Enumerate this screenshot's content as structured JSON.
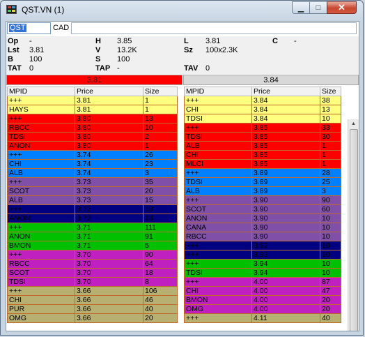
{
  "window": {
    "title": "QST.VN (1)"
  },
  "symbol": {
    "value": "QST",
    "exchange": "CAD"
  },
  "quote": {
    "op_label": "Op",
    "op": "-",
    "h_label": "H",
    "h": "3.85",
    "l_label": "L",
    "l": "3.81",
    "c_label": "C",
    "c": "-",
    "lst_label": "Lst",
    "lst": "3.81",
    "v_label": "V",
    "v": "13.2K",
    "sz_label": "Sz",
    "sz": "100x2.3K",
    "b_label": "B",
    "b": "100",
    "s_label": "S",
    "s": "100",
    "tat_label": "TAT",
    "tat": "0",
    "tap_label": "TAP",
    "tap": "-",
    "tav_label": "TAV",
    "tav": "0"
  },
  "bid_price": "3.81",
  "ask_price": "3.84",
  "headers": {
    "mpid": "MPID",
    "price": "Price",
    "size": "Size"
  },
  "bids": [
    {
      "mpid": "+++",
      "price": "3.81",
      "size": "1",
      "bg": "#ffff80",
      "fg": "#000"
    },
    {
      "mpid": "HAYS",
      "price": "3.81",
      "size": "1",
      "bg": "#ffff80",
      "fg": "#000"
    },
    {
      "mpid": "+++",
      "price": "3.80",
      "size": "13",
      "bg": "#ff0000",
      "fg": "#000"
    },
    {
      "mpid": "RBCC",
      "price": "3.80",
      "size": "10",
      "bg": "#ff0000",
      "fg": "#000"
    },
    {
      "mpid": "TDSI",
      "price": "3.80",
      "size": "2",
      "bg": "#ff0000",
      "fg": "#000"
    },
    {
      "mpid": "ANON",
      "price": "3.80",
      "size": "1",
      "bg": "#ff0000",
      "fg": "#000"
    },
    {
      "mpid": "+++",
      "price": "3.74",
      "size": "26",
      "bg": "#0080ff",
      "fg": "#000"
    },
    {
      "mpid": "CHI",
      "price": "3.74",
      "size": "23",
      "bg": "#0080ff",
      "fg": "#000"
    },
    {
      "mpid": "ALB",
      "price": "3.74",
      "size": "3",
      "bg": "#0080ff",
      "fg": "#000"
    },
    {
      "mpid": "+++",
      "price": "3.73",
      "size": "35",
      "bg": "#8050a8",
      "fg": "#000"
    },
    {
      "mpid": "SCOT",
      "price": "3.73",
      "size": "20",
      "bg": "#8050a8",
      "fg": "#000"
    },
    {
      "mpid": "ALB",
      "price": "3.73",
      "size": "15",
      "bg": "#8050a8",
      "fg": "#000"
    },
    {
      "mpid": "+++",
      "price": "3.72",
      "size": "18",
      "bg": "#000080",
      "fg": "#000"
    },
    {
      "mpid": "ANON",
      "price": "3.72",
      "size": "18",
      "bg": "#000080",
      "fg": "#000"
    },
    {
      "mpid": "+++",
      "price": "3.71",
      "size": "111",
      "bg": "#00c000",
      "fg": "#000"
    },
    {
      "mpid": "ANON",
      "price": "3.71",
      "size": "91",
      "bg": "#00c000",
      "fg": "#000"
    },
    {
      "mpid": "BMON",
      "price": "3.71",
      "size": "5",
      "bg": "#00c000",
      "fg": "#000"
    },
    {
      "mpid": "+++",
      "price": "3.70",
      "size": "90",
      "bg": "#c020c0",
      "fg": "#000"
    },
    {
      "mpid": "RBCC",
      "price": "3.70",
      "size": "64",
      "bg": "#c020c0",
      "fg": "#000"
    },
    {
      "mpid": "SCOT",
      "price": "3.70",
      "size": "18",
      "bg": "#c020c0",
      "fg": "#000"
    },
    {
      "mpid": "TDSI",
      "price": "3.70",
      "size": "8",
      "bg": "#c020c0",
      "fg": "#000"
    },
    {
      "mpid": "+++",
      "price": "3.66",
      "size": "106",
      "bg": "#b8b070",
      "fg": "#000"
    },
    {
      "mpid": "CHI",
      "price": "3.66",
      "size": "46",
      "bg": "#b8b070",
      "fg": "#000"
    },
    {
      "mpid": "PUR",
      "price": "3.66",
      "size": "40",
      "bg": "#b8b070",
      "fg": "#000"
    },
    {
      "mpid": "OMG",
      "price": "3.66",
      "size": "20",
      "bg": "#b8b070",
      "fg": "#000"
    }
  ],
  "asks": [
    {
      "mpid": "+++",
      "price": "3.84",
      "size": "38",
      "bg": "#ffff80",
      "fg": "#000"
    },
    {
      "mpid": "CHI",
      "price": "3.84",
      "size": "13",
      "bg": "#ffff80",
      "fg": "#000"
    },
    {
      "mpid": "TDSI",
      "price": "3.84",
      "size": "10",
      "bg": "#ffff80",
      "fg": "#000"
    },
    {
      "mpid": "+++",
      "price": "3.85",
      "size": "33",
      "bg": "#ff0000",
      "fg": "#000"
    },
    {
      "mpid": "TDSI",
      "price": "3.85",
      "size": "30",
      "bg": "#ff0000",
      "fg": "#000"
    },
    {
      "mpid": "ALB",
      "price": "3.85",
      "size": "1",
      "bg": "#ff0000",
      "fg": "#000"
    },
    {
      "mpid": "CHI",
      "price": "3.85",
      "size": "1",
      "bg": "#ff0000",
      "fg": "#000"
    },
    {
      "mpid": "MLCI",
      "price": "3.85",
      "size": "1",
      "bg": "#ff0000",
      "fg": "#000"
    },
    {
      "mpid": "+++",
      "price": "3.89",
      "size": "28",
      "bg": "#0080ff",
      "fg": "#000"
    },
    {
      "mpid": "TDSI",
      "price": "3.89",
      "size": "25",
      "bg": "#0080ff",
      "fg": "#000"
    },
    {
      "mpid": "ALB",
      "price": "3.89",
      "size": "3",
      "bg": "#0080ff",
      "fg": "#000"
    },
    {
      "mpid": "+++",
      "price": "3.90",
      "size": "90",
      "bg": "#8050a8",
      "fg": "#000"
    },
    {
      "mpid": "SCOT",
      "price": "3.90",
      "size": "60",
      "bg": "#8050a8",
      "fg": "#000"
    },
    {
      "mpid": "ANON",
      "price": "3.90",
      "size": "10",
      "bg": "#8050a8",
      "fg": "#000"
    },
    {
      "mpid": "CANA",
      "price": "3.90",
      "size": "10",
      "bg": "#8050a8",
      "fg": "#000"
    },
    {
      "mpid": "RBCC",
      "price": "3.90",
      "size": "10",
      "bg": "#8050a8",
      "fg": "#000"
    },
    {
      "mpid": "+++",
      "price": "3.92",
      "size": "10",
      "bg": "#000080",
      "fg": "#000"
    },
    {
      "mpid": "+++",
      "price": "3.93",
      "size": "10",
      "bg": "#000080",
      "fg": "#000"
    },
    {
      "mpid": "+++",
      "price": "3.94",
      "size": "10",
      "bg": "#00c000",
      "fg": "#000"
    },
    {
      "mpid": "TDSI",
      "price": "3.94",
      "size": "10",
      "bg": "#00c000",
      "fg": "#000"
    },
    {
      "mpid": "+++",
      "price": "4.00",
      "size": "87",
      "bg": "#c020c0",
      "fg": "#000"
    },
    {
      "mpid": "CHI",
      "price": "4.00",
      "size": "47",
      "bg": "#c020c0",
      "fg": "#000"
    },
    {
      "mpid": "BMON",
      "price": "4.00",
      "size": "20",
      "bg": "#c020c0",
      "fg": "#000"
    },
    {
      "mpid": "OMG",
      "price": "4.00",
      "size": "20",
      "bg": "#c020c0",
      "fg": "#000"
    },
    {
      "mpid": "+++",
      "price": "4.11",
      "size": "40",
      "bg": "#b8b070",
      "fg": "#000"
    }
  ]
}
